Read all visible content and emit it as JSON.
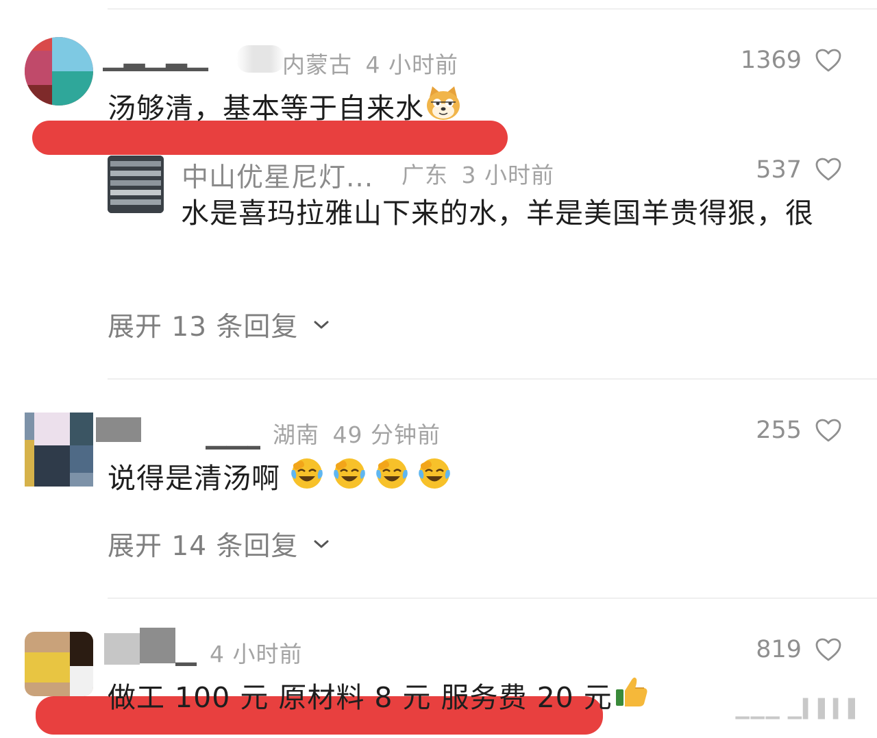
{
  "comments": [
    {
      "location": "内蒙古",
      "time": "4 小时前",
      "likes": "1369",
      "text": "汤够清，基本等于自来水",
      "emoji": "doge-face",
      "reply": {
        "name": "中山优星尼灯...",
        "location": "广东",
        "time": "3 小时前",
        "likes": "537",
        "text": "水是喜玛拉雅山下来的水，羊是美国羊贵得狠，很"
      },
      "expand_label": "展开 13 条回复"
    },
    {
      "location": "湖南",
      "time": "49 分钟前",
      "likes": "255",
      "text": "说得是清汤啊",
      "emoji": "crying-laughing-face",
      "expand_label": "展开 14 条回复"
    },
    {
      "time": "4 小时前",
      "likes": "819",
      "text": "做工 100 元 原材料 8 元 服务费 20 元",
      "emoji": "thumbs-up"
    }
  ],
  "icons": {
    "like": "heart-outline-icon",
    "expand": "chevron-down-icon"
  },
  "colors": {
    "highlight": "#e8403f",
    "meta": "#a3a3a3",
    "text": "#1e1e1e"
  }
}
